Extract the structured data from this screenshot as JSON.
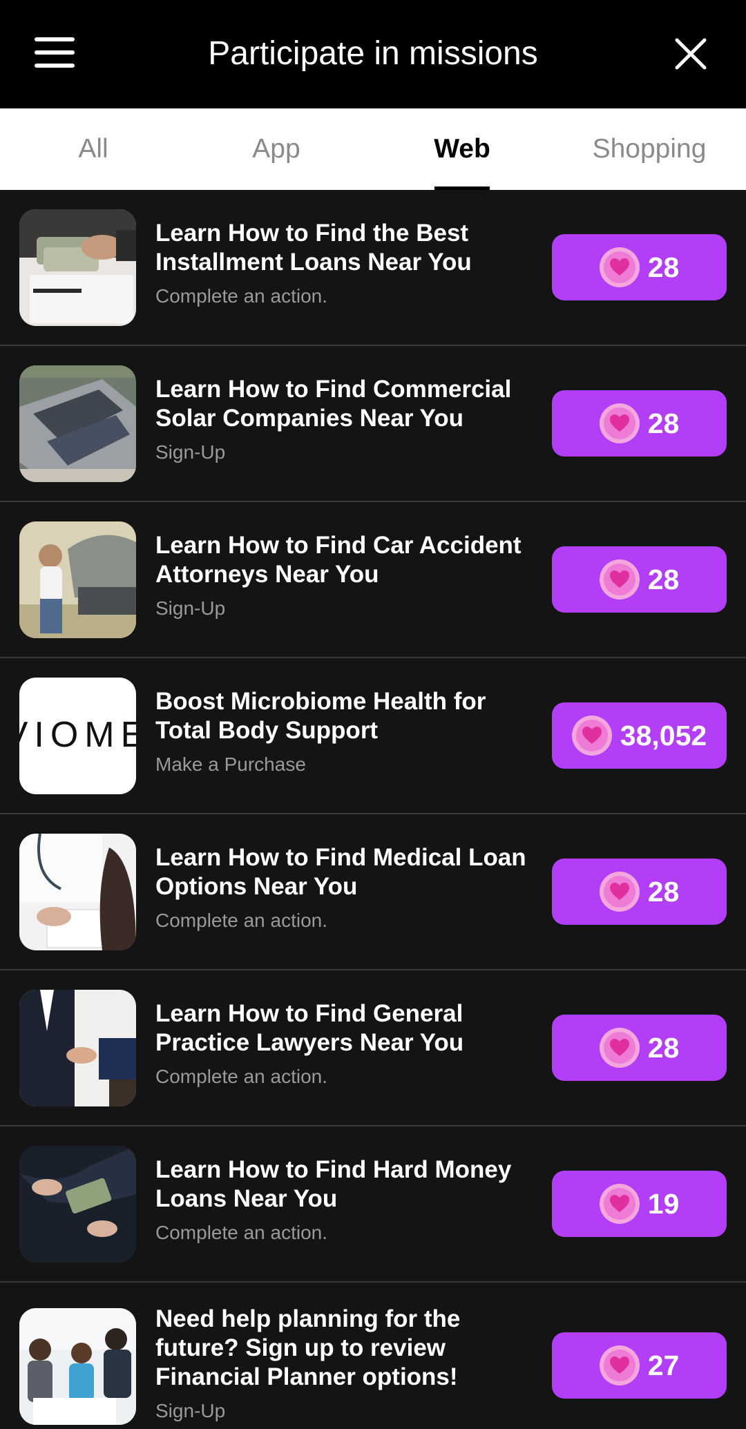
{
  "header": {
    "title": "Participate in missions"
  },
  "tabs": [
    {
      "label": "All",
      "active": false
    },
    {
      "label": "App",
      "active": false
    },
    {
      "label": "Web",
      "active": true
    },
    {
      "label": "Shopping",
      "active": false
    }
  ],
  "colors": {
    "reward_bg": "#b23ef7",
    "heart": "#e0309f",
    "heart_ring": "#f4a6df"
  },
  "missions": [
    {
      "title": "Learn How to Find the Best Installment Loans Near You",
      "subtitle": "Complete an action.",
      "reward": "28",
      "image": "money-counting-photo"
    },
    {
      "title": "Learn How to Find Commercial Solar Companies Near You",
      "subtitle": "Sign-Up",
      "reward": "28",
      "image": "solar-roof-aerial-photo"
    },
    {
      "title": "Learn How to Find Car Accident Attorneys Near You",
      "subtitle": "Sign-Up",
      "reward": "28",
      "image": "woman-phone-car-photo"
    },
    {
      "title": "Boost Microbiome Health for Total Body Support",
      "subtitle": "Make a Purchase",
      "reward": "38,052",
      "image": "viome-logo",
      "logo_text": "VIOME"
    },
    {
      "title": "Learn How to Find Medical Loan Options Near You",
      "subtitle": "Complete an action.",
      "reward": "28",
      "image": "doctor-consultation-photo"
    },
    {
      "title": "Learn How to Find General Practice Lawyers Near You",
      "subtitle": "Complete an action.",
      "reward": "28",
      "image": "handshake-photo"
    },
    {
      "title": "Learn How to Find Hard Money Loans Near You",
      "subtitle": "Complete an action.",
      "reward": "19",
      "image": "cash-exchange-photo"
    },
    {
      "title": "Need help planning for the future? Sign up to review Financial Planner options!",
      "subtitle": "Sign-Up",
      "reward": "27",
      "image": "financial-planner-meeting-photo"
    }
  ]
}
